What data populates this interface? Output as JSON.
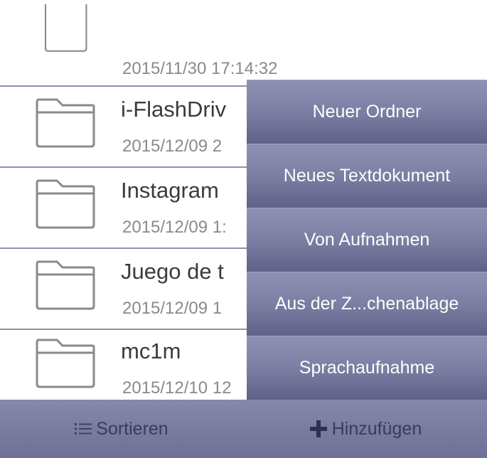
{
  "files": [
    {
      "name": "",
      "date": "2015/11/30 17:14:32"
    },
    {
      "name": "i-FlashDriv",
      "date": "2015/12/09 2"
    },
    {
      "name": "Instagram",
      "date": "2015/12/09 1:"
    },
    {
      "name": "Juego de t",
      "date": "2015/12/09 1"
    },
    {
      "name": "mc1m",
      "date": "2015/12/10 12"
    }
  ],
  "menu": {
    "items": [
      {
        "label": "Neuer Ordner"
      },
      {
        "label": "Neues Textdokument"
      },
      {
        "label": "Von Aufnahmen"
      },
      {
        "label": "Aus der Z...chenablage"
      },
      {
        "label": "Sprachaufnahme"
      }
    ]
  },
  "toolbar": {
    "sort_label": "Sortieren",
    "add_label": "Hinzufügen",
    "sort_icon": "list-icon",
    "add_icon": "plus-icon"
  },
  "colors": {
    "menu_bg": "#7c7ea3",
    "toolbar_bg": "#787aa0",
    "divider": "#8d8fb0"
  }
}
